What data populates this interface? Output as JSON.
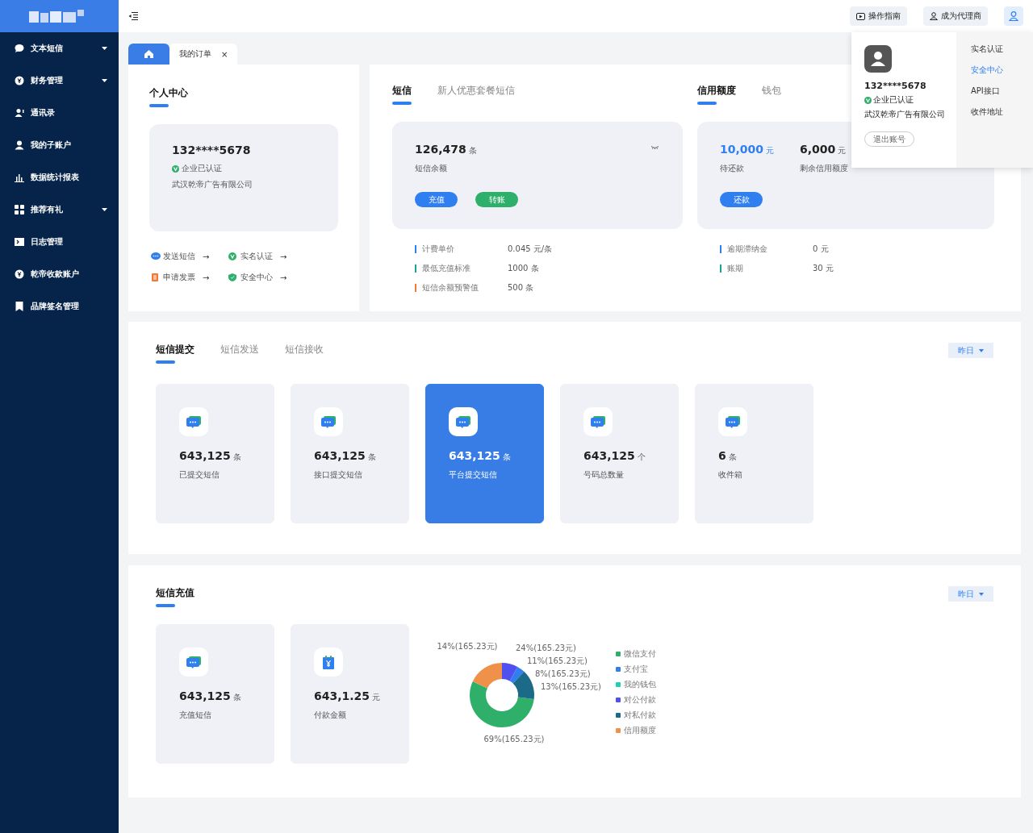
{
  "sidebar": {
    "items": [
      {
        "label": "文本短信",
        "has_caret": true
      },
      {
        "label": "财务管理",
        "has_caret": true
      },
      {
        "label": "通讯录",
        "has_caret": false
      },
      {
        "label": "我的子账户",
        "has_caret": false
      },
      {
        "label": "数据统计报表",
        "has_caret": false
      },
      {
        "label": "推荐有礼",
        "has_caret": true
      },
      {
        "label": "日志管理",
        "has_caret": false
      },
      {
        "label": "乾帝收款账户",
        "has_caret": false
      },
      {
        "label": "品牌签名管理",
        "has_caret": false
      }
    ]
  },
  "header": {
    "buttons": [
      "操作指南",
      "成为代理商"
    ]
  },
  "page_tabs": [
    {
      "kind": "home",
      "selected": true
    },
    {
      "kind": "page",
      "label": "我的订单",
      "close": "×",
      "selected": false
    }
  ],
  "personal": {
    "title": "个人中心",
    "phone": "132****5678",
    "verified": "企业已认证",
    "company": "武汉乾帝广告有限公司",
    "links": [
      {
        "label": "发送短信",
        "arrow": "→"
      },
      {
        "label": "实名认证",
        "arrow": "→"
      },
      {
        "label": "申请发票",
        "arrow": "→"
      },
      {
        "label": "安全中心",
        "arrow": "→"
      }
    ]
  },
  "sms": {
    "tabs": [
      {
        "label": "短信",
        "selected": true
      },
      {
        "label": "新人优惠套餐短信",
        "selected": false
      }
    ],
    "balance": "126,478",
    "unit": "条",
    "caption": "短信余额",
    "buttons": [
      {
        "label": "充值",
        "kind": "primary"
      },
      {
        "label": "转账",
        "kind": "success"
      }
    ],
    "details": [
      {
        "label": "计费单价",
        "value": "0.045 元/条",
        "color": "#2f7ff0"
      },
      {
        "label": "最低充值标准",
        "value": "1000 条",
        "color": "#17a2a0"
      },
      {
        "label": "短信余额预警值",
        "value": "500 条",
        "color": "#f0793a"
      }
    ]
  },
  "credit": {
    "tabs": [
      {
        "label": "信用额度",
        "selected": true
      },
      {
        "label": "钱包",
        "selected": false
      }
    ],
    "items": [
      {
        "value": "10,000",
        "unit": "元",
        "caption": "待还款",
        "highlight": true
      },
      {
        "value": "6,000",
        "unit": "元",
        "caption": "剩余信用额度",
        "highlight": false
      }
    ],
    "button": "还款",
    "details": [
      {
        "label": "逾期滞纳金",
        "value": "0 元",
        "color": "#2f7ff0"
      },
      {
        "label": "账期",
        "value": "30 元",
        "color": "#17a2a0"
      }
    ]
  },
  "submit": {
    "tabs": [
      {
        "label": "短信提交",
        "selected": true
      },
      {
        "label": "短信发送",
        "selected": false
      },
      {
        "label": "短信接收",
        "selected": false
      }
    ],
    "filter": "昨日",
    "cards": [
      {
        "value": "643,125",
        "unit": "条",
        "caption": "已提交短信",
        "selected": false
      },
      {
        "value": "643,125",
        "unit": "条",
        "caption": "接口提交短信",
        "selected": false
      },
      {
        "value": "643,125",
        "unit": "条",
        "caption": "平台提交短信",
        "selected": true
      },
      {
        "value": "643,125",
        "unit": "个",
        "caption": "号码总数量",
        "selected": false
      },
      {
        "value": "6",
        "unit": "条",
        "caption": "收件箱",
        "selected": false
      }
    ]
  },
  "recharge": {
    "title": "短信充值",
    "filter": "昨日",
    "cards": [
      {
        "value": "643,125",
        "unit": "条",
        "caption": "充值短信",
        "selected": false
      },
      {
        "value": "643,1.25",
        "unit": "元",
        "caption": "付款金额",
        "selected": false
      }
    ],
    "legend_items": [
      {
        "color": "#2fb06a"
      },
      {
        "color": "#2f7ff0"
      },
      {
        "color": "#1fd1b0"
      },
      {
        "color": "#5050f0"
      },
      {
        "color": "#1a6a88"
      },
      {
        "color": "#f0914a"
      }
    ],
    "chart_data": {
      "type": "donut",
      "legend": "right",
      "categories": [
        "微信支付",
        "支付宝",
        "我的钱包",
        "对公付款",
        "对私付款",
        "信用额度"
      ],
      "values": [
        55,
        4,
        0,
        8,
        15,
        18
      ],
      "annotations": [
        "14%(165.23元)",
        "24%(165.23元)",
        "11%(165.23元)",
        "8%(165.23元)",
        "13%(165.23元)",
        "69%(165.23元)"
      ]
    }
  },
  "account_menu": {
    "phone": "132****5678",
    "verified": "企业已认证",
    "company": "武汉乾帝广告有限公司",
    "logout": "退出账号",
    "items": [
      {
        "label": "实名认证",
        "selected": false
      },
      {
        "label": "安全中心",
        "selected": true
      },
      {
        "label": "API接口",
        "selected": false
      },
      {
        "label": "收件地址",
        "selected": false
      }
    ]
  }
}
